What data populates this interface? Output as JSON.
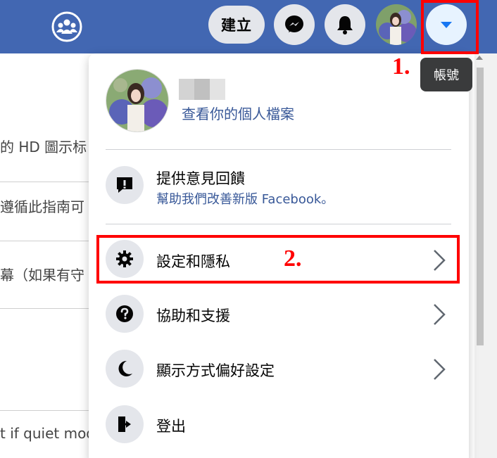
{
  "header": {
    "create_label": "建立",
    "account_tooltip": "帳號"
  },
  "annotations": {
    "step1": "1.",
    "step2": "2."
  },
  "background": {
    "line1": "的 HD 圖示标",
    "line2": "遵循此指南可",
    "line3": "幕（如果有守",
    "line4": "t if quiet mod"
  },
  "menu": {
    "profile_link": "查看你的個人檔案",
    "feedback": {
      "label": "提供意見回饋",
      "sub": "幫助我們改善新版 Facebook。"
    },
    "items": [
      {
        "label": "設定和隱私",
        "icon": "gear-icon"
      },
      {
        "label": "協助和支援",
        "icon": "question-icon"
      },
      {
        "label": "顯示方式偏好設定",
        "icon": "moon-icon"
      },
      {
        "label": "登出",
        "icon": "logout-icon"
      }
    ]
  },
  "colors": {
    "topbar": "#4267b2",
    "link": "#385898",
    "annotation": "#ff0000",
    "account_caret": "#1877f2"
  }
}
